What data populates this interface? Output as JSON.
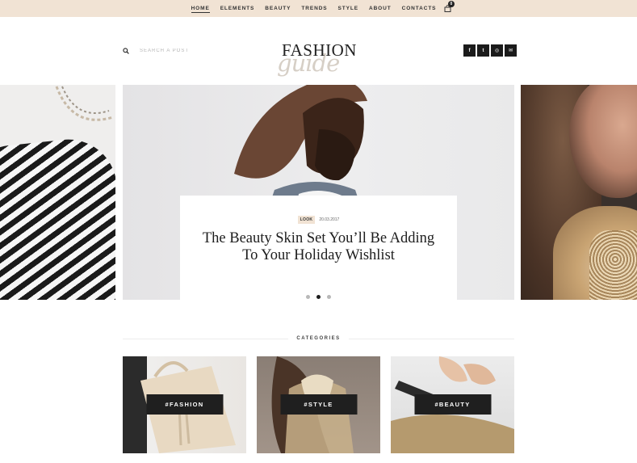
{
  "nav": {
    "items": [
      {
        "label": "HOME",
        "active": true
      },
      {
        "label": "ELEMENTS"
      },
      {
        "label": "BEAUTY"
      },
      {
        "label": "TRENDS"
      },
      {
        "label": "STYLE"
      },
      {
        "label": "ABOUT"
      },
      {
        "label": "CONTACTS"
      }
    ],
    "cart_count": "0"
  },
  "search": {
    "placeholder": "SEARCH A POST"
  },
  "logo": {
    "main": "FASHION",
    "script": "guide"
  },
  "socials": [
    {
      "icon": "facebook-icon",
      "glyph": "f"
    },
    {
      "icon": "twitter-icon",
      "glyph": "t"
    },
    {
      "icon": "instagram-icon",
      "glyph": "◎"
    },
    {
      "icon": "email-icon",
      "glyph": "✉"
    }
  ],
  "slider": {
    "tag": "LOOK",
    "date": "20.03.2017",
    "title": "The Beauty Skin Set You’ll Be Adding To Your Holiday Wishlist",
    "dots": 3,
    "active_dot": 1
  },
  "categories": {
    "title": "CATEGORIES",
    "items": [
      {
        "label": "#FASHION"
      },
      {
        "label": "#STYLE"
      },
      {
        "label": "#BEAUTY"
      }
    ]
  },
  "colors": {
    "accent": "#f1e3d4",
    "dark": "#1f1f1f"
  }
}
